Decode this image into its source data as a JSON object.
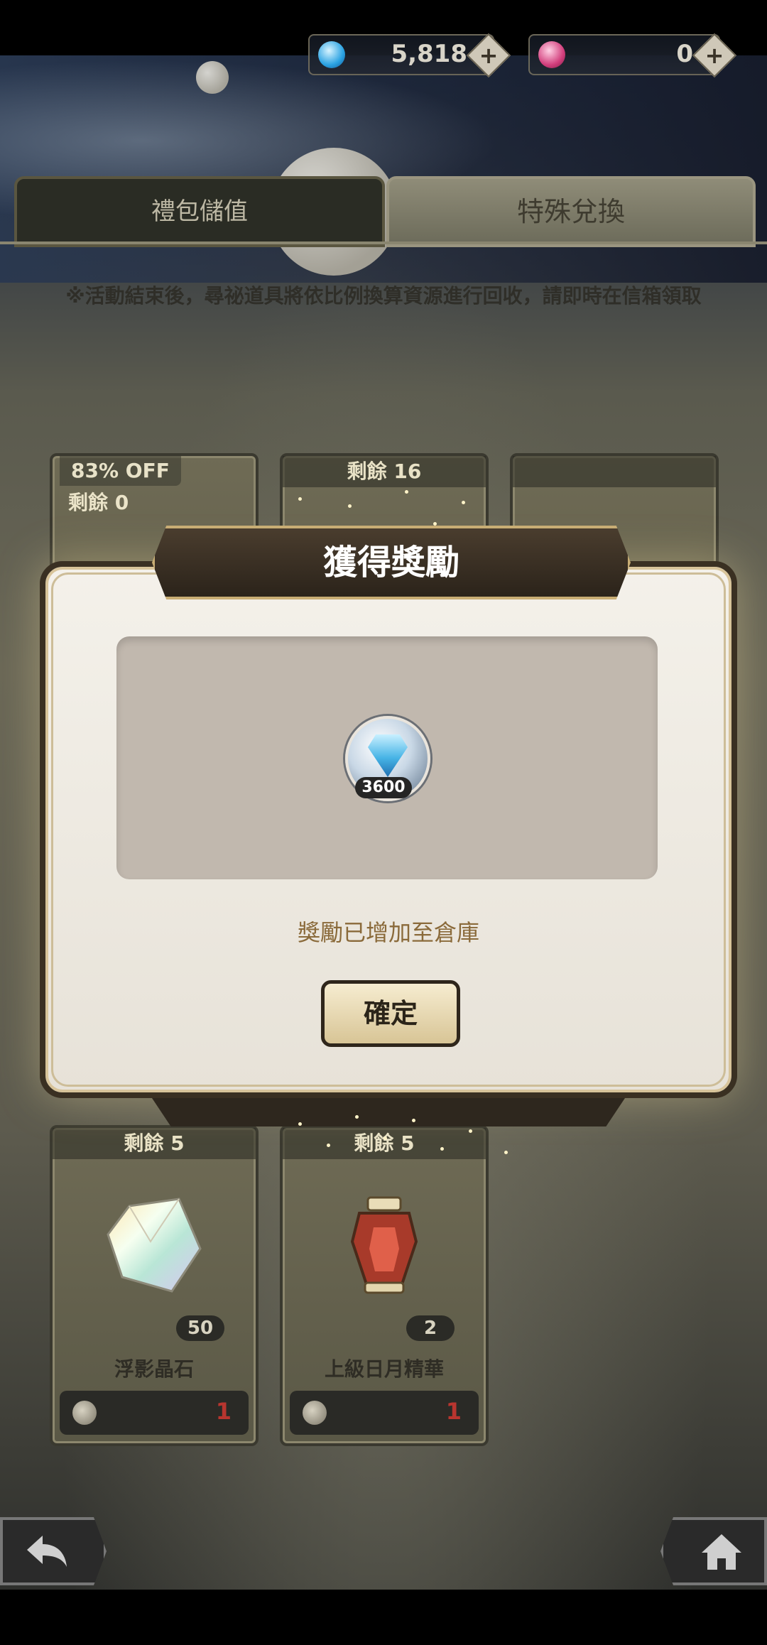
{
  "currency": {
    "gems": {
      "icon": "blue-gem-icon",
      "value": "5,818"
    },
    "stones": {
      "icon": "pink-stone-icon",
      "value": "0"
    },
    "plus_label": "+"
  },
  "tabs": [
    {
      "label": "禮包儲值",
      "active": false
    },
    {
      "label": "特殊兌換",
      "active": true
    }
  ],
  "notice": "※活動結束後，尋祕道具將依比例換算資源進行回收，請即時在信箱領取",
  "cards_top": [
    {
      "badge_off": "83% OFF",
      "remaining": "剩餘 0"
    },
    {
      "remaining": "剩餘 16"
    },
    {
      "remaining": ""
    }
  ],
  "cards_bottom": [
    {
      "remaining": "剩餘 5",
      "icon": "prism-crystal-icon",
      "qty": "50",
      "name": "浮影晶石",
      "cost": "1"
    },
    {
      "remaining": "剩餘 5",
      "icon": "lantern-essence-icon",
      "qty": "2",
      "name": "上級日月精華",
      "cost": "1"
    }
  ],
  "modal": {
    "title": "獲得獎勵",
    "reward": {
      "icon": "diamond-gem-icon",
      "count": "3600"
    },
    "message": "獎勵已增加至倉庫",
    "confirm_label": "確定"
  },
  "colors": {
    "accent": "#c8ad74",
    "cost_red": "#b8352f"
  }
}
